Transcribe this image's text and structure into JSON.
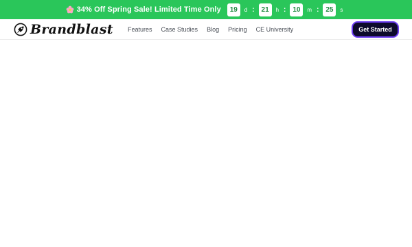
{
  "promo": {
    "icon": "flower-icon",
    "text": "34% Off Spring Sale! Limited Time Only",
    "countdown": [
      {
        "value": "19",
        "unit": "d"
      },
      {
        "value": "21",
        "unit": "h"
      },
      {
        "value": "10",
        "unit": "m"
      },
      {
        "value": "25",
        "unit": "s"
      }
    ],
    "separator": ":",
    "colors": {
      "background": "#2ac65a",
      "box_text": "#1f8a3f"
    }
  },
  "header": {
    "logo_text": "Brandblast",
    "logo_icon": "rocket-icon",
    "nav": [
      {
        "label": "Features"
      },
      {
        "label": "Case Studies"
      },
      {
        "label": "Blog"
      },
      {
        "label": "Pricing"
      },
      {
        "label": "CE University"
      }
    ],
    "cta_label": "Get Started",
    "colors": {
      "cta_background": "#0d0a2b",
      "cta_border": "#6b3cf0"
    }
  }
}
